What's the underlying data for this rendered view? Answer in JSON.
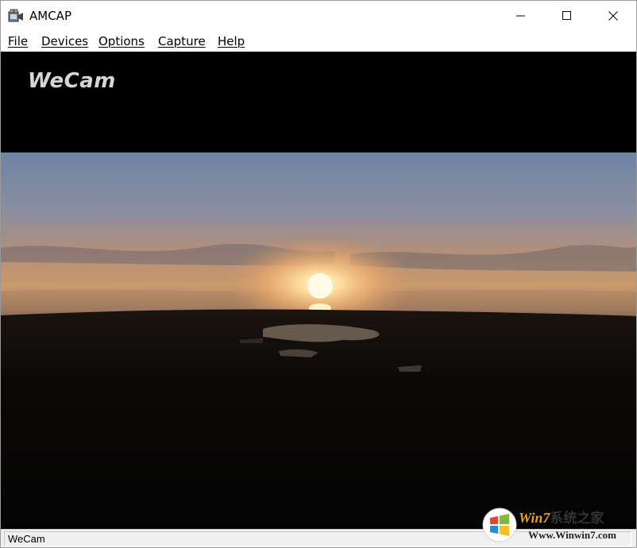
{
  "window": {
    "title": "AMCAP",
    "controls": {
      "minimize": "minimize",
      "maximize": "maximize",
      "close": "close"
    }
  },
  "menu": {
    "items": [
      "File",
      "Devices",
      "Options",
      "Capture",
      "Help"
    ]
  },
  "video": {
    "overlay_logo": "WeCam"
  },
  "status": {
    "text": "WeCam"
  },
  "watermark": {
    "brand_win": "Win7",
    "brand_cn": "系统之家",
    "url": "Www.Winwin7.com"
  },
  "colors": {
    "title_bg": "#ffffff",
    "video_bg": "#000000",
    "status_bg": "#f0f0f0",
    "watermark_accent": "#e8a020"
  }
}
